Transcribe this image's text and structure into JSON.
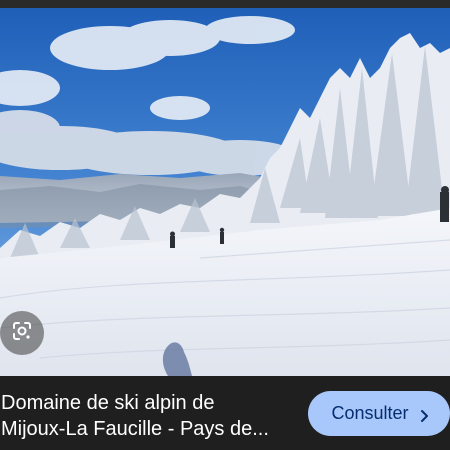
{
  "image": {
    "subject": "ski-slope-photo"
  },
  "caption": {
    "line1": "Domaine de ski alpin de",
    "line2": "Mijoux-La Faucille - Pays de..."
  },
  "actions": {
    "consult_label": "Consulter",
    "consult_icon": "chevron-right-icon",
    "lens_icon": "google-lens-icon"
  },
  "colors": {
    "button_bg": "#a8c7fa",
    "button_text": "#062e6f",
    "background": "#1f1f1f"
  }
}
